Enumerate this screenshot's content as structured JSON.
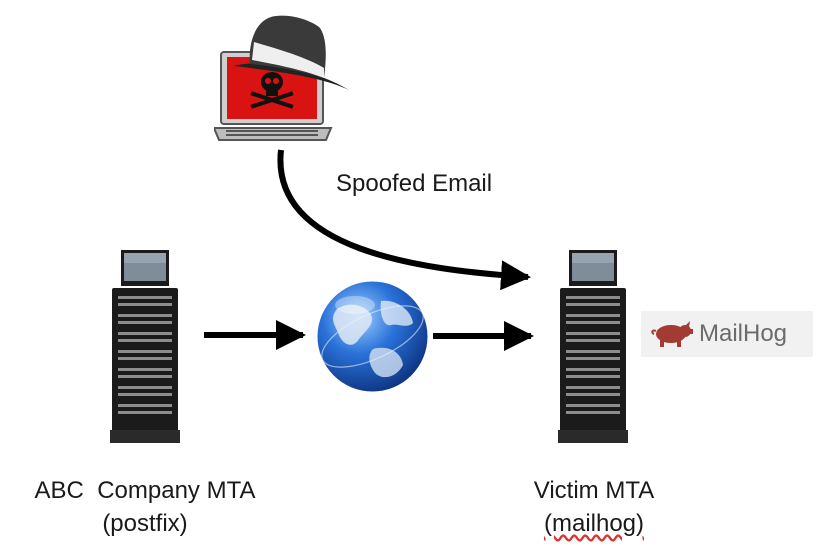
{
  "labels": {
    "spoofed_email": "Spoofed Email",
    "abc_line1": "ABC  Company MTA",
    "abc_line2": "(postfix)",
    "victim_line1": "Victim MTA",
    "victim_line2": "(mailhog)",
    "mailhog_logo": "MailHog"
  },
  "colors": {
    "arrow": "#000000",
    "laptop_screen": "#d91212",
    "server_body": "#1b1b1b",
    "globe": "#1f5fd6",
    "mailhog_pig": "#a33a34"
  },
  "icons": [
    "hacker-laptop-icon",
    "server-icon",
    "globe-icon",
    "pig-icon"
  ]
}
